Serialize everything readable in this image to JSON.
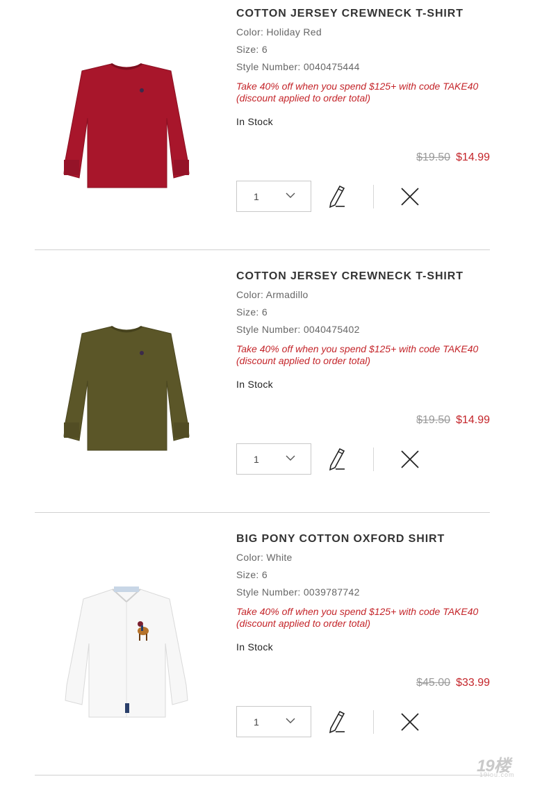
{
  "items": [
    {
      "title": "COTTON JERSEY CREWNECK T-SHIRT",
      "color_label": "Color:",
      "color": "Holiday Red",
      "size_label": "Size:",
      "size": "6",
      "style_label": "Style Number:",
      "style_number": "0040475444",
      "promo": "Take 40% off when you spend $125+ with code TAKE40 (discount applied to order total)",
      "stock": "In Stock",
      "original_price": "$19.50",
      "sale_price": "$14.99",
      "quantity": "1",
      "image_icon": "red-long-sleeve-tshirt",
      "garment_color": "#a8162b"
    },
    {
      "title": "COTTON JERSEY CREWNECK T-SHIRT",
      "color_label": "Color:",
      "color": "Armadillo",
      "size_label": "Size:",
      "size": "6",
      "style_label": "Style Number:",
      "style_number": "0040475402",
      "promo": "Take 40% off when you spend $125+ with code TAKE40 (discount applied to order total)",
      "stock": "In Stock",
      "original_price": "$19.50",
      "sale_price": "$14.99",
      "quantity": "1",
      "image_icon": "olive-long-sleeve-tshirt",
      "garment_color": "#5b5628"
    },
    {
      "title": "BIG PONY COTTON OXFORD SHIRT",
      "color_label": "Color:",
      "color": "White",
      "size_label": "Size:",
      "size": "6",
      "style_label": "Style Number:",
      "style_number": "0039787742",
      "promo": "Take 40% off when you spend $125+ with code TAKE40 (discount applied to order total)",
      "stock": "In Stock",
      "original_price": "$45.00",
      "sale_price": "$33.99",
      "quantity": "1",
      "image_icon": "white-oxford-shirt",
      "garment_color": "#f7f7f7"
    }
  ],
  "icons": {
    "quantity_dropdown": "chevron-down-icon",
    "edit": "pencil-icon",
    "remove": "close-icon"
  },
  "colors": {
    "promo": "#c4252a",
    "sale_price": "#c4252a",
    "original_price": "#999999",
    "divider": "#d0d0d0"
  },
  "watermark": {
    "main": "19楼",
    "sub": "19lou.com"
  }
}
